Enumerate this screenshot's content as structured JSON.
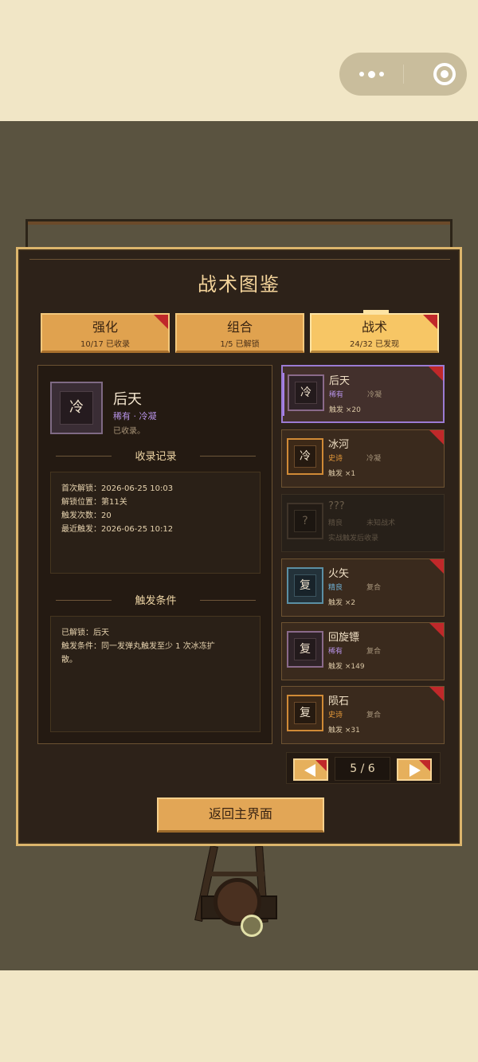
{
  "title": "战术图鉴",
  "tabs": [
    {
      "label": "强化",
      "sub": "10/17 已收录",
      "active": false
    },
    {
      "label": "组合",
      "sub": "1/5 已解锁",
      "active": false
    },
    {
      "label": "战术",
      "sub": "24/32 已发现",
      "active": true
    }
  ],
  "detail": {
    "icon_glyph": "冷",
    "name": "后天",
    "rarity": "稀有",
    "separator": "·",
    "series": "冷凝",
    "state": "已收录。",
    "record_title": "收录记录",
    "record_lines": [
      "首次解锁：2026-06-25 10:03",
      "解锁位置：第11关",
      "触发次数：20",
      "最近触发：2026-06-25 10:12"
    ],
    "condition_title": "触发条件",
    "condition_lines": [
      "已解锁：后天",
      "触发条件：同一发弹丸触发至少 1 次冰冻扩",
      "散。"
    ]
  },
  "cards": [
    {
      "glyph": "冷",
      "name": "后天",
      "rarity": "稀有",
      "type": "冷凝",
      "count": "触发 ×20",
      "rarity_color": "#b692e6"
    },
    {
      "glyph": "冷",
      "name": "冰河",
      "rarity": "史诗",
      "type": "冷凝",
      "count": "触发 ×1",
      "rarity_color": "#e79a3a"
    },
    {
      "glyph": "?",
      "name": "???",
      "rarity": "精良",
      "type": "未知战术",
      "count": "实战触发后收录",
      "rarity_color": "#5f5344"
    },
    {
      "glyph": "复",
      "name": "火矢",
      "rarity": "精良",
      "type": "复合",
      "count": "触发 ×2",
      "rarity_color": "#6fb2d6"
    },
    {
      "glyph": "复",
      "name": "回旋镖",
      "rarity": "稀有",
      "type": "复合",
      "count": "触发 ×149",
      "rarity_color": "#b692e6"
    },
    {
      "glyph": "复",
      "name": "陨石",
      "rarity": "史诗",
      "type": "复合",
      "count": "触发 ×31",
      "rarity_color": "#e79a3a"
    }
  ],
  "pager": {
    "text": "5 / 6",
    "prev_icon": "left-arrow-icon",
    "next_icon": "right-arrow-icon"
  },
  "back_label": "返回主界面",
  "colors": {
    "accent": "#f7c665",
    "panel_border": "#dcb56c",
    "new_badge": "#c0282a"
  }
}
